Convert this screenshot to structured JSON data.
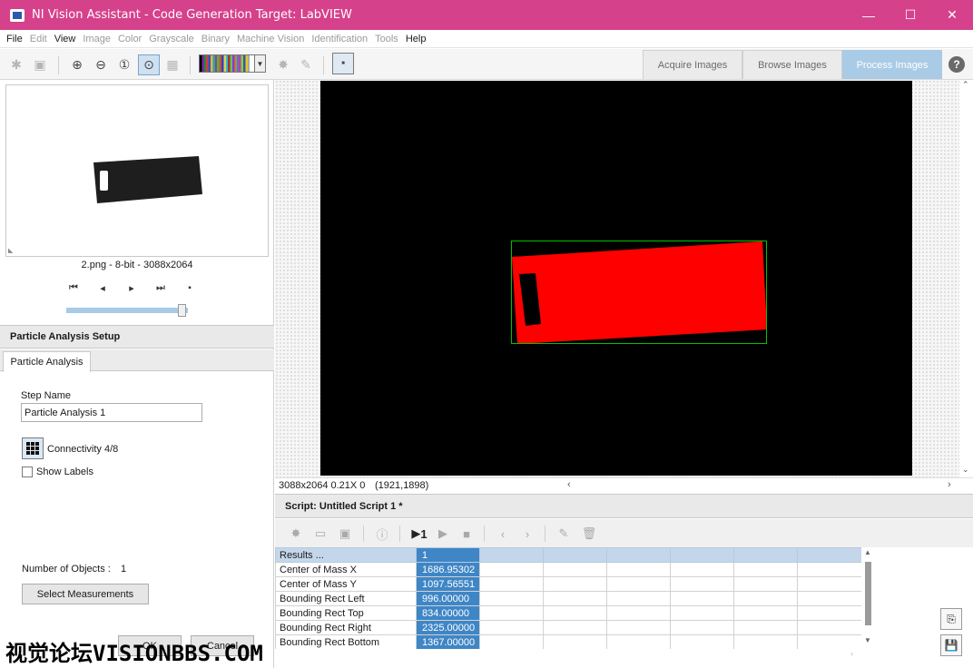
{
  "window": {
    "title": "NI Vision Assistant - Code Generation Target: LabVIEW",
    "minimize_glyph": "—",
    "maximize_glyph": "☐",
    "close_glyph": "✕"
  },
  "menu": [
    "File",
    "Edit",
    "View",
    "Image",
    "Color",
    "Grayscale",
    "Binary",
    "Machine Vision",
    "Identification",
    "Tools",
    "Help"
  ],
  "menu_disabled": [
    false,
    true,
    false,
    true,
    true,
    true,
    true,
    true,
    true,
    true,
    false
  ],
  "mode_tabs": {
    "acquire": "Acquire Images",
    "browse": "Browse Images",
    "process": "Process Images",
    "active": "Process Images"
  },
  "help_glyph": "?",
  "thumbnail": {
    "caption": "2.png - 8-bit - 3088x2064"
  },
  "browser_slider_fraction": 0.95,
  "setup": {
    "header": "Particle Analysis Setup",
    "tab": "Particle Analysis",
    "step_name_label": "Step Name",
    "step_name_value": "Particle Analysis 1",
    "connectivity_label": "Connectivity 4/8",
    "show_labels_label": "Show Labels",
    "show_labels_checked": false,
    "objects_label": "Number of Objects :",
    "objects_value": "1",
    "select_measurements": "Select Measurements",
    "ok": "OK",
    "cancel": "Cancel"
  },
  "status_bar": {
    "info": "3088x2064 0.21X 0",
    "coords": "(1921,1898)"
  },
  "script": {
    "header": "Script: Untitled Script 1 *",
    "run_once_label": "1"
  },
  "results": {
    "header_label": "Results ...",
    "column": "1",
    "rows": [
      {
        "label": "Center of Mass X",
        "value": "1686.95302"
      },
      {
        "label": "Center of Mass Y",
        "value": "1097.56551"
      },
      {
        "label": "Bounding Rect Left",
        "value": "996.00000"
      },
      {
        "label": "Bounding Rect Top",
        "value": "834.00000"
      },
      {
        "label": "Bounding Rect Right",
        "value": "2325.00000"
      },
      {
        "label": "Bounding Rect Bottom",
        "value": "1367.00000"
      }
    ]
  },
  "watermark": "视觉论坛VISIONBBS.COM",
  "colors": {
    "titlebar": "#d6418c",
    "particle": "#ff0000",
    "bounding_box": "#00c000",
    "selection": "#3f86c6"
  }
}
